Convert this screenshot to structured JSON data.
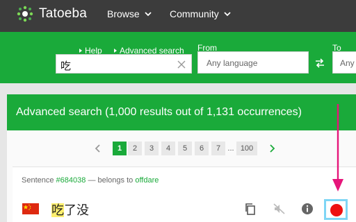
{
  "app": {
    "brand": "Tatoeba",
    "nav": [
      "Browse",
      "Community"
    ]
  },
  "search": {
    "help_label": "Help",
    "advanced_label": "Advanced search",
    "query": "吃",
    "from_label": "From",
    "from_value": "Any language",
    "to_label": "To",
    "to_value": "Any language"
  },
  "results": {
    "title": "Advanced search (1,000 results out of 1,131 occurrences)"
  },
  "pagination": {
    "pages": [
      "1",
      "2",
      "3",
      "4",
      "5",
      "6",
      "7",
      "...",
      "100"
    ],
    "current": "1"
  },
  "sentence": {
    "prefix": "Sentence",
    "id": "#684038",
    "belongs": "— belongs to",
    "owner": "offdare",
    "highlight": "吃",
    "rest": "了没",
    "flag": "china-flag"
  },
  "colors": {
    "brand_green": "#1aaa3a",
    "topbar": "#3c3c3c",
    "annotation_pink": "#e6157a",
    "record_red": "#ee1111",
    "highlight_yellow": "#ffef6e"
  },
  "icons": [
    "tatoeba-logo-icon",
    "chevron-down-icon",
    "clear-icon",
    "swap-icon",
    "copy-icon",
    "audio-muted-icon",
    "info-icon",
    "record-icon"
  ]
}
